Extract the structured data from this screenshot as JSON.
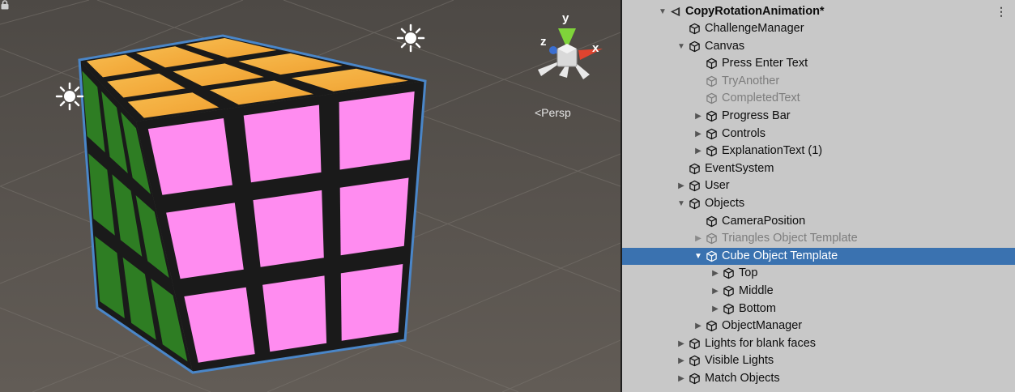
{
  "scene_view": {
    "gizmo": {
      "y_label": "y",
      "x_label": "x",
      "z_label": "z"
    },
    "projection_label": "<Persp",
    "colors": {
      "background": "#5a5550",
      "cube_top": "#f5a83b",
      "cube_left": "#2e7d23",
      "cube_front": "#ff8cf0",
      "selection_outline": "#4a86c8"
    }
  },
  "hierarchy": {
    "scene_name": "CopyRotationAnimation*",
    "items": [
      {
        "label": "ChallengeManager",
        "depth": 1,
        "expander": "none",
        "state": "normal"
      },
      {
        "label": "Canvas",
        "depth": 1,
        "expander": "expanded",
        "state": "normal"
      },
      {
        "label": "Press Enter Text",
        "depth": 2,
        "expander": "none",
        "state": "normal"
      },
      {
        "label": "TryAnother",
        "depth": 2,
        "expander": "none",
        "state": "disabled"
      },
      {
        "label": "CompletedText",
        "depth": 2,
        "expander": "none",
        "state": "disabled"
      },
      {
        "label": "Progress Bar",
        "depth": 2,
        "expander": "collapsed",
        "state": "normal"
      },
      {
        "label": "Controls",
        "depth": 2,
        "expander": "collapsed",
        "state": "normal"
      },
      {
        "label": "ExplanationText (1)",
        "depth": 2,
        "expander": "collapsed",
        "state": "normal"
      },
      {
        "label": "EventSystem",
        "depth": 1,
        "expander": "none",
        "state": "normal"
      },
      {
        "label": "User",
        "depth": 1,
        "expander": "collapsed",
        "state": "normal"
      },
      {
        "label": "Objects",
        "depth": 1,
        "expander": "expanded",
        "state": "normal"
      },
      {
        "label": "CameraPosition",
        "depth": 2,
        "expander": "none",
        "state": "normal"
      },
      {
        "label": "Triangles Object Template",
        "depth": 2,
        "expander": "collapsed",
        "state": "disabled"
      },
      {
        "label": "Cube Object Template",
        "depth": 2,
        "expander": "expanded",
        "state": "selected"
      },
      {
        "label": "Top",
        "depth": 3,
        "expander": "collapsed",
        "state": "normal"
      },
      {
        "label": "Middle",
        "depth": 3,
        "expander": "collapsed",
        "state": "normal"
      },
      {
        "label": "Bottom",
        "depth": 3,
        "expander": "collapsed",
        "state": "normal"
      },
      {
        "label": "ObjectManager",
        "depth": 2,
        "expander": "collapsed",
        "state": "normal"
      },
      {
        "label": "Lights for blank faces",
        "depth": 1,
        "expander": "collapsed",
        "state": "normal"
      },
      {
        "label": "Visible Lights",
        "depth": 1,
        "expander": "collapsed",
        "state": "normal"
      },
      {
        "label": "Match Objects",
        "depth": 1,
        "expander": "collapsed",
        "state": "normal"
      }
    ],
    "colors": {
      "panel": "#c8c8c8",
      "selected_row": "#3a72b0",
      "disabled_text": "#7d7d7d"
    }
  }
}
